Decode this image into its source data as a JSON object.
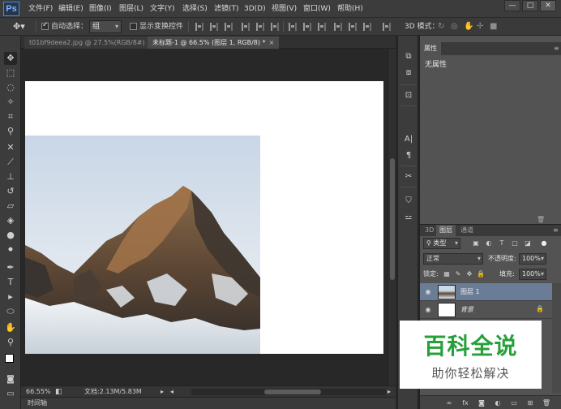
{
  "app": {
    "logo": "Ps"
  },
  "menu": [
    "文件(F)",
    "编辑(E)",
    "图像(I)",
    "图层(L)",
    "文字(Y)",
    "选择(S)",
    "滤镜(T)",
    "3D(D)",
    "视图(V)",
    "窗口(W)",
    "帮助(H)"
  ],
  "window_controls": {
    "minimize": "—",
    "maximize": "□",
    "close": "✕"
  },
  "options": {
    "auto_select_label": "自动选择：",
    "auto_select_value": "组",
    "show_transform_label": "显示变换控件",
    "mode_3d_label": "3D 模式："
  },
  "tabs": [
    {
      "label": "t01bf9deea2.jpg @ 27.5%(RGB/8#)",
      "close": "×"
    },
    {
      "label": "未标题-1 @ 66.5% (图层 1, RGB/8) *",
      "close": "×"
    }
  ],
  "status": {
    "zoom": "66.55%",
    "doc_info": "文档:2.13M/5.83M"
  },
  "timeline_label": "时间轴",
  "properties": {
    "tab": "属性",
    "body": "无属性"
  },
  "layers": {
    "tabs": [
      "3D",
      "图层",
      "通道"
    ],
    "filter_kind": "类型",
    "blend_mode": "正常",
    "opacity_label": "不透明度:",
    "opacity_value": "100%",
    "lock_label": "锁定:",
    "fill_label": "填充:",
    "fill_value": "100%",
    "items": [
      {
        "name": "图层 1",
        "selected": true
      },
      {
        "name": "背景",
        "selected": false
      }
    ]
  },
  "watermark": {
    "title": "百科全说",
    "subtitle": "助你轻松解决"
  },
  "colors": {
    "accent_selection": "#6b7c97",
    "panel_bg": "#535353",
    "watermark_green": "#27a03a"
  }
}
